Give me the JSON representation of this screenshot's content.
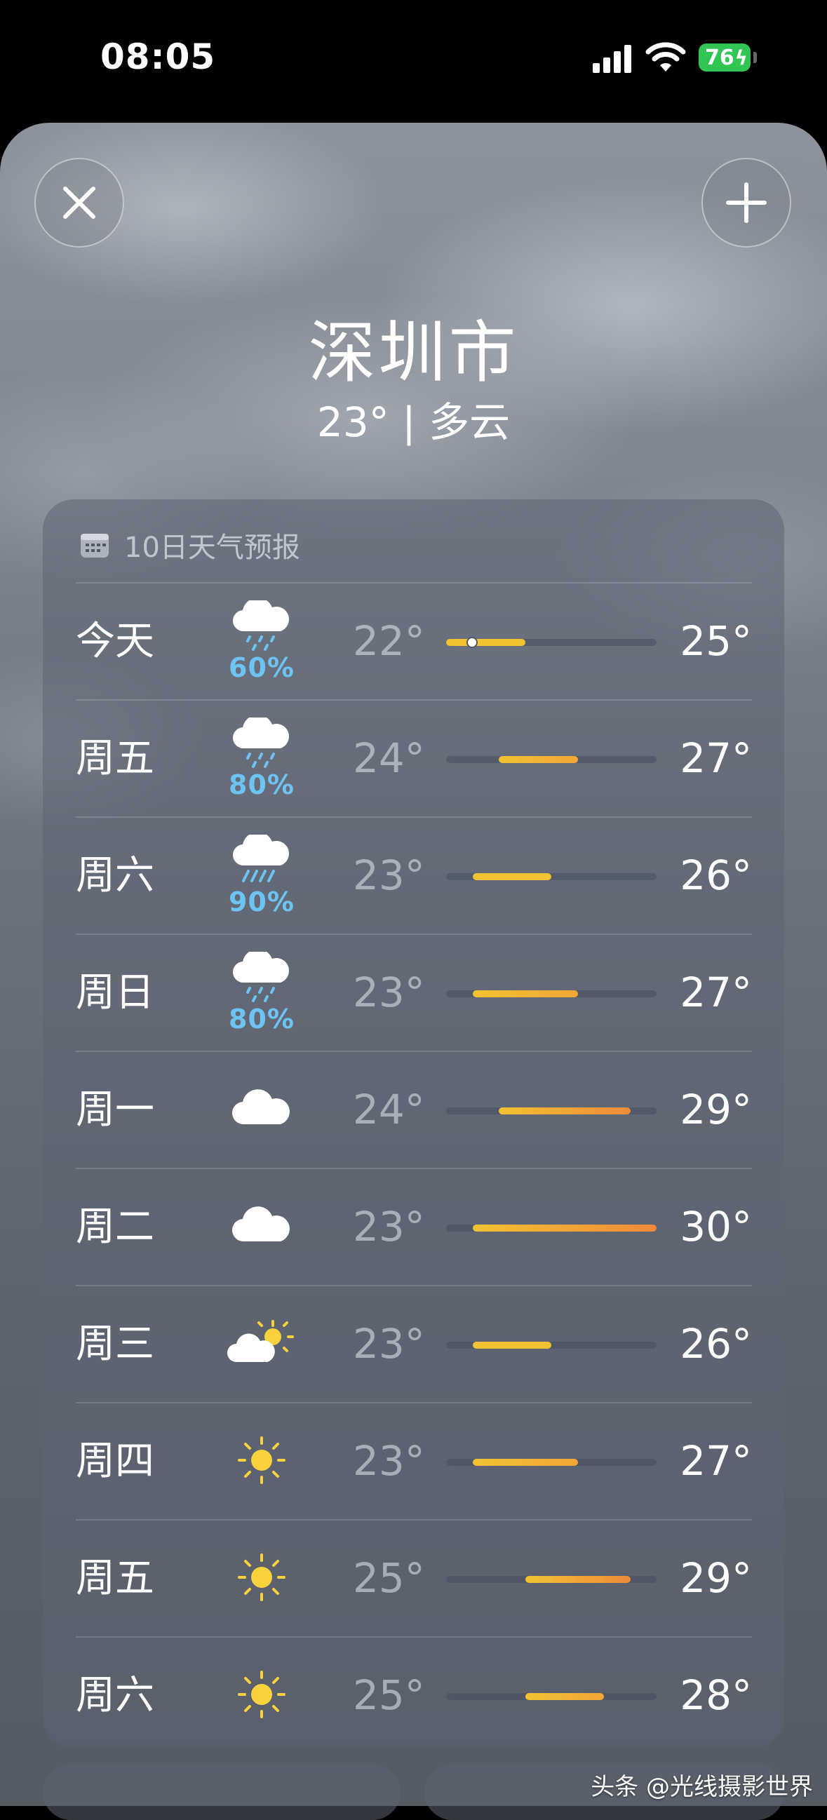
{
  "status_bar": {
    "time": "08:05",
    "battery": "76"
  },
  "header": {
    "city": "深圳市",
    "summary": "23° | 多云"
  },
  "forecast": {
    "title": "10日天气预报",
    "scale_min": 22,
    "scale_max": 30,
    "current_temp": 23,
    "days": [
      {
        "day": "今天",
        "icon": "rain-cloud-icon",
        "precip": "60%",
        "low": "22°",
        "high": "25°",
        "low_val": 22,
        "high_val": 25
      },
      {
        "day": "周五",
        "icon": "rain-cloud-icon",
        "precip": "80%",
        "low": "24°",
        "high": "27°",
        "low_val": 24,
        "high_val": 27
      },
      {
        "day": "周六",
        "icon": "heavy-rain-cloud-icon",
        "precip": "90%",
        "low": "23°",
        "high": "26°",
        "low_val": 23,
        "high_val": 26
      },
      {
        "day": "周日",
        "icon": "rain-cloud-icon",
        "precip": "80%",
        "low": "23°",
        "high": "27°",
        "low_val": 23,
        "high_val": 27
      },
      {
        "day": "周一",
        "icon": "cloud-icon",
        "precip": "",
        "low": "24°",
        "high": "29°",
        "low_val": 24,
        "high_val": 29
      },
      {
        "day": "周二",
        "icon": "cloud-icon",
        "precip": "",
        "low": "23°",
        "high": "30°",
        "low_val": 23,
        "high_val": 30
      },
      {
        "day": "周三",
        "icon": "partly-sunny-icon",
        "precip": "",
        "low": "23°",
        "high": "26°",
        "low_val": 23,
        "high_val": 26
      },
      {
        "day": "周四",
        "icon": "sun-icon",
        "precip": "",
        "low": "23°",
        "high": "27°",
        "low_val": 23,
        "high_val": 27
      },
      {
        "day": "周五",
        "icon": "sun-icon",
        "precip": "",
        "low": "25°",
        "high": "29°",
        "low_val": 25,
        "high_val": 29
      },
      {
        "day": "周六",
        "icon": "sun-icon",
        "precip": "",
        "low": "25°",
        "high": "28°",
        "low_val": 25,
        "high_val": 28
      }
    ]
  },
  "watermark": "头条 @光线摄影世界",
  "colors": {
    "precip": "#6dc4f2",
    "bar_cool": "#f2c232",
    "bar_warm": "#ef8a3a",
    "sun": "#f7d23d"
  }
}
